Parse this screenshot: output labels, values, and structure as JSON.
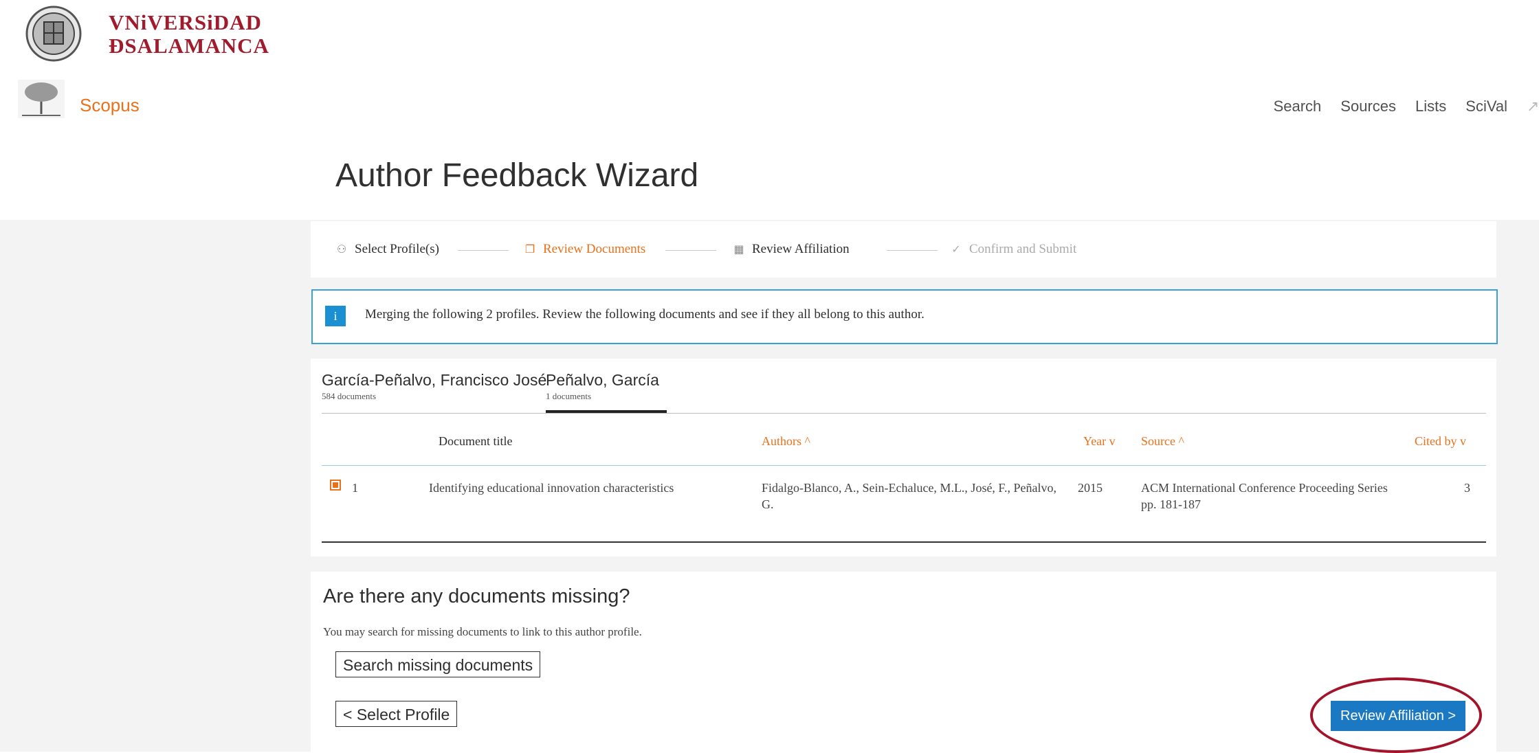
{
  "header": {
    "university_line1": "VNiVERSiDAD",
    "university_line2": "ÐSALAMANCA",
    "university_logo_icon": "university-seal-icon",
    "scopus_logo_icon": "elsevier-tree-icon",
    "scopus_name": "Scopus",
    "nav": [
      "Search",
      "Sources",
      "Lists",
      "SciVal"
    ]
  },
  "page_title": "Author Feedback Wizard",
  "steps": [
    {
      "label": "Select Profile(s)",
      "icon": "people-icon",
      "state": "completed"
    },
    {
      "label": "Review Documents",
      "icon": "document-icon",
      "state": "active"
    },
    {
      "label": "Review Affiliation",
      "icon": "building-icon",
      "state": "completed"
    },
    {
      "label": "Confirm and Submit",
      "icon": "check-icon",
      "state": "pending"
    }
  ],
  "info": {
    "icon": "i",
    "text": "Merging the following 2 profiles. Review the following documents and see if they all belong to this author."
  },
  "profiles": [
    {
      "name": "García-Peñalvo, Francisco José",
      "count": "584 documents"
    },
    {
      "name": "Peñalvo, García",
      "count": "1 documents"
    }
  ],
  "table": {
    "headers": {
      "title": "Document title",
      "authors": "Authors ^",
      "year": "Year v",
      "source": "Source ^",
      "cited": "Cited by v"
    },
    "rows": [
      {
        "index": "1",
        "title": "Identifying educational innovation characteristics",
        "authors": "Fidalgo-Blanco, A., Sein-Echaluce, M.L., José, F., Peñalvo, G.",
        "year": "2015",
        "source": "ACM International Conference Proceeding Series",
        "pages": "pp. 181-187",
        "cited": "3"
      }
    ]
  },
  "missing": {
    "title": "Are there any documents missing?",
    "text": "You may search for missing documents to link to this author profile.",
    "search_button": "Search missing documents"
  },
  "footer": {
    "back_button": "< Select Profile",
    "next_button": "Review Affiliation >"
  },
  "colors": {
    "accent_orange": "#e9711c",
    "primary_blue": "#1b79c4",
    "university_red": "#a01c2c",
    "highlight_circle": "#a3132a"
  }
}
